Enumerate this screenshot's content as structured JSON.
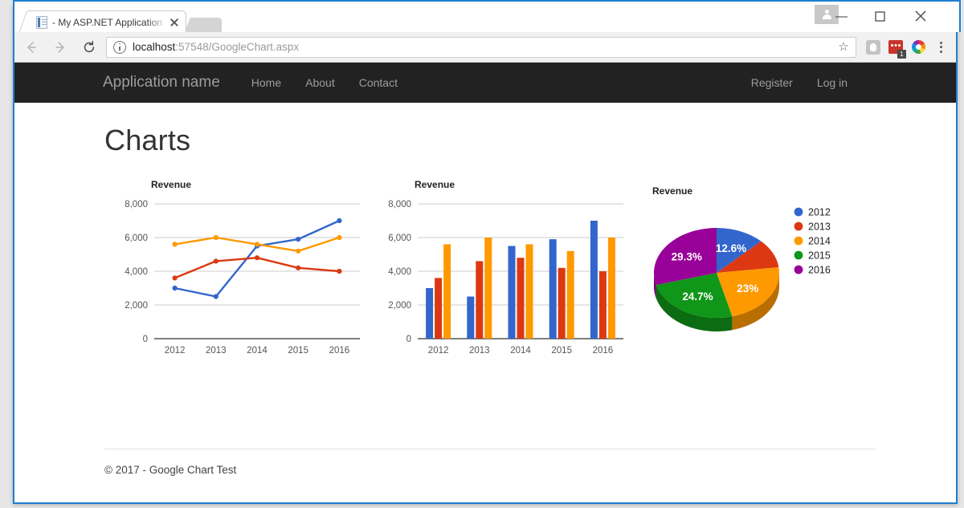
{
  "browser": {
    "tab_title": "- My ASP.NET Application",
    "url_host": "localhost",
    "url_rest": ":57548/GoogleChart.aspx",
    "adblock_badge": "1",
    "minimize_glyph": "—",
    "maximize_glyph": "☐",
    "close_glyph": "✕",
    "star_glyph": "☆"
  },
  "site": {
    "brand": "Application name",
    "nav_left": [
      "Home",
      "About",
      "Contact"
    ],
    "nav_right": [
      "Register",
      "Log in"
    ],
    "page_title": "Charts",
    "footer": "© 2017 - Google Chart Test"
  },
  "colors": {
    "series_2012": "#3366cc",
    "series_2013": "#dc3912",
    "series_2014": "#ff9900",
    "series_2015": "#109618",
    "series_2016": "#990099",
    "navbar_bg": "#222222",
    "navbar_text": "#9d9d9d",
    "window_border": "#1f7fd0"
  },
  "chart_data": [
    {
      "type": "line",
      "title": "Revenue",
      "categories": [
        "2012",
        "2013",
        "2014",
        "2015",
        "2016"
      ],
      "series": [
        {
          "name": "2012",
          "color": "#3366cc",
          "values": [
            3000,
            2500,
            5500,
            5900,
            7000
          ]
        },
        {
          "name": "2013",
          "color": "#dc3912",
          "values": [
            3600,
            4600,
            4800,
            4200,
            4000
          ]
        },
        {
          "name": "2014",
          "color": "#ff9900",
          "values": [
            5600,
            6000,
            5600,
            5200,
            6000
          ]
        }
      ],
      "xlabel": "",
      "ylabel": "",
      "ylim": [
        0,
        8000
      ],
      "yticks": [
        0,
        2000,
        4000,
        6000,
        8000
      ],
      "yticklabels": [
        "0",
        "2,000",
        "4,000",
        "6,000",
        "8,000"
      ],
      "grid": true,
      "legend": "none"
    },
    {
      "type": "bar",
      "title": "Revenue",
      "categories": [
        "2012",
        "2013",
        "2014",
        "2015",
        "2016"
      ],
      "series": [
        {
          "name": "2012",
          "color": "#3366cc",
          "values": [
            3000,
            2500,
            5500,
            5900,
            7000
          ]
        },
        {
          "name": "2013",
          "color": "#dc3912",
          "values": [
            3600,
            4600,
            4800,
            4200,
            4000
          ]
        },
        {
          "name": "2014",
          "color": "#ff9900",
          "values": [
            5600,
            6000,
            5600,
            5200,
            6000
          ]
        }
      ],
      "xlabel": "",
      "ylabel": "",
      "ylim": [
        0,
        8000
      ],
      "yticks": [
        0,
        2000,
        4000,
        6000,
        8000
      ],
      "yticklabels": [
        "0",
        "2,000",
        "4,000",
        "6,000",
        "8,000"
      ],
      "grid": true,
      "legend": "none"
    },
    {
      "type": "pie",
      "title": "Revenue",
      "is_3d": true,
      "legend": "right",
      "labels": [
        "2012",
        "2013",
        "2014",
        "2015",
        "2016"
      ],
      "percent_labels": [
        "12.6%",
        "",
        "23%",
        "24.7%",
        "29.3%"
      ],
      "percents": [
        12.6,
        10.4,
        23.0,
        24.7,
        29.3
      ],
      "colors": [
        "#3366cc",
        "#dc3912",
        "#ff9900",
        "#109618",
        "#990099"
      ]
    }
  ]
}
